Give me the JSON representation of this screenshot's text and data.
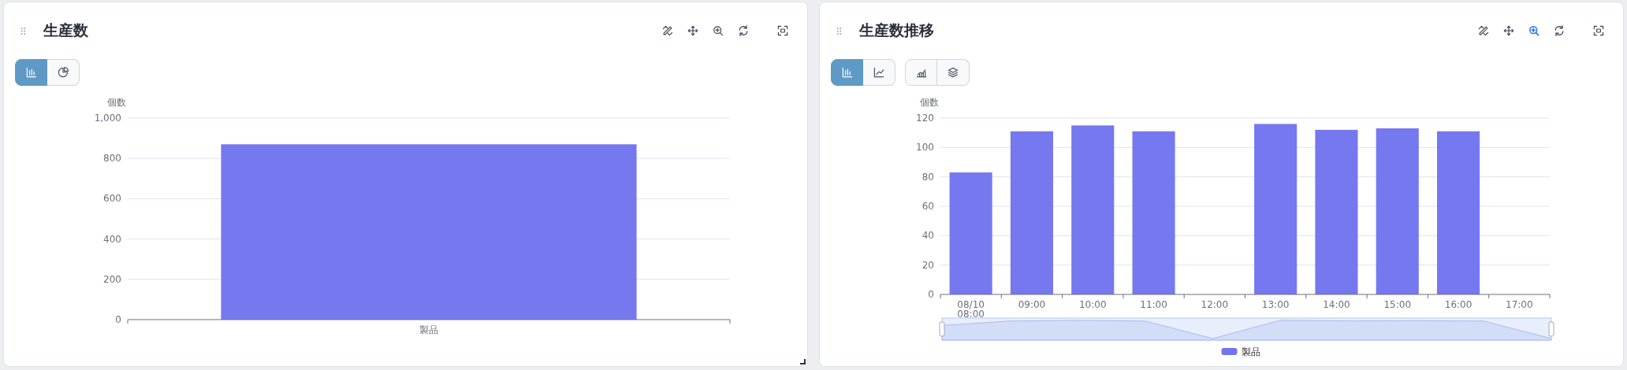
{
  "panels": [
    {
      "title": "生産数",
      "tools": [
        {
          "kind": "edit",
          "active": false
        },
        {
          "kind": "move",
          "active": false
        },
        {
          "kind": "zoom",
          "active": false
        },
        {
          "kind": "refresh",
          "active": false
        },
        {
          "kind": "fullscreen",
          "active": false
        }
      ],
      "toggle_groups": [
        [
          {
            "kind": "bar",
            "selected": true
          },
          {
            "kind": "pie",
            "selected": false
          }
        ]
      ],
      "chart_data": {
        "type": "bar",
        "grid": true,
        "ylabel": "個数",
        "categories": [
          "製品"
        ],
        "series": [
          {
            "color": "#7375ef",
            "values": [
              870
            ]
          }
        ],
        "ylim": [
          0,
          1000
        ],
        "yticks": [
          0,
          200,
          400,
          600,
          800,
          {
            "value": 1000,
            "label": "1,000"
          }
        ]
      },
      "legend": false,
      "data_zoom": false
    },
    {
      "title": "生産数推移",
      "tools": [
        {
          "kind": "edit",
          "active": false
        },
        {
          "kind": "move",
          "active": false
        },
        {
          "kind": "zoom",
          "active": true
        },
        {
          "kind": "refresh",
          "active": false
        },
        {
          "kind": "fullscreen",
          "active": false
        }
      ],
      "toggle_groups": [
        [
          {
            "kind": "bar",
            "selected": true
          },
          {
            "kind": "line",
            "selected": false
          }
        ],
        [
          {
            "kind": "area",
            "selected": false
          },
          {
            "kind": "stack",
            "selected": false
          }
        ]
      ],
      "chart_data": {
        "type": "bar",
        "grid": true,
        "ylabel": "個数",
        "categories": [
          "08/10\n08:00",
          "09:00",
          "10:00",
          "11:00",
          "12:00",
          "13:00",
          "14:00",
          "15:00",
          "16:00",
          "17:00"
        ],
        "series": [
          {
            "name": "製品",
            "color": "#7375ef",
            "values": [
              83,
              111,
              115,
              111,
              0,
              116,
              112,
              113,
              111,
              0
            ]
          }
        ],
        "ylim": [
          0,
          120
        ],
        "yticks": [
          0,
          20,
          40,
          60,
          80,
          100,
          120
        ]
      },
      "legend": true,
      "data_zoom": true
    }
  ]
}
